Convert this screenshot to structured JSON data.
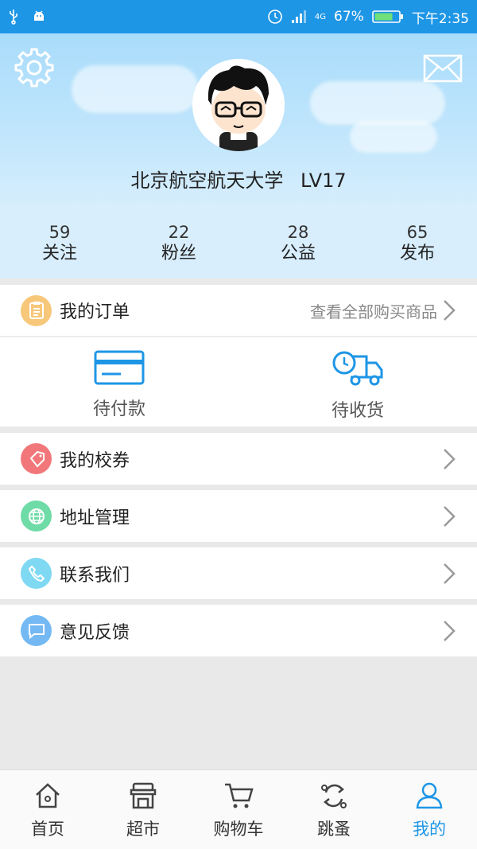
{
  "status_bar": {
    "battery": "67%",
    "network": "4G",
    "time": "下午2:35"
  },
  "profile": {
    "name": "北京航空航天大学",
    "level": "LV17"
  },
  "stats": [
    {
      "value": "59",
      "label": "关注"
    },
    {
      "value": "22",
      "label": "粉丝"
    },
    {
      "value": "28",
      "label": "公益"
    },
    {
      "value": "65",
      "label": "发布"
    }
  ],
  "orders": {
    "title": "我的订单",
    "view_all": "查看全部购买商品",
    "pending_payment": "待付款",
    "pending_receipt": "待收货"
  },
  "menu": [
    {
      "label": "我的校券",
      "icon": "ticket-icon",
      "color": "#f2777a"
    },
    {
      "label": "地址管理",
      "icon": "globe-icon",
      "color": "#6fdba6"
    },
    {
      "label": "联系我们",
      "icon": "phone-icon",
      "color": "#7fd9f2"
    },
    {
      "label": "意见反馈",
      "icon": "feedback-icon",
      "color": "#74b9f3"
    }
  ],
  "tabbar": [
    {
      "label": "首页",
      "icon": "home-icon"
    },
    {
      "label": "超市",
      "icon": "store-icon"
    },
    {
      "label": "购物车",
      "icon": "cart-icon"
    },
    {
      "label": "跳蚤",
      "icon": "exchange-icon"
    },
    {
      "label": "我的",
      "icon": "user-icon"
    }
  ],
  "colors": {
    "accent": "#1e96e6",
    "order_icon": "#f7c77a"
  }
}
